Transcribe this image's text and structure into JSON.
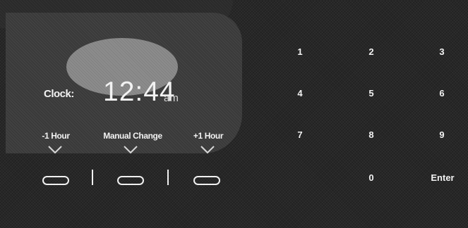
{
  "clock": {
    "label": "Clock:",
    "time": "12:44",
    "ampm": "am"
  },
  "adjust": {
    "minus_label": "-1 Hour",
    "manual_label": "Manual Change",
    "plus_label": "+1 Hour"
  },
  "keypad": {
    "k1": "1",
    "k2": "2",
    "k3": "3",
    "k4": "4",
    "k5": "5",
    "k6": "6",
    "k7": "7",
    "k8": "8",
    "k9": "9",
    "k0": "0",
    "enter": "Enter"
  },
  "icons": {
    "chevron": "chevron-down-icon",
    "button": "pill-button-icon"
  }
}
